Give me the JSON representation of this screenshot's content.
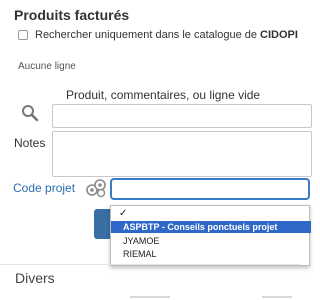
{
  "section": {
    "title": "Produits facturés",
    "search_catalog_prefix": "Rechercher uniquement dans le catalogue de ",
    "search_catalog_bold": "CIDOPI",
    "no_line": "Aucune ligne"
  },
  "product": {
    "label": "Produit, commentaires, ou ligne vide",
    "value": ""
  },
  "notes": {
    "label": "Notes",
    "value": ""
  },
  "code_projet": {
    "label": "Code projet",
    "value": "",
    "options": {
      "checkmark": "✓",
      "items": [
        "ASPBTP - Conseils ponctuels projet",
        "JYAMOE",
        "RIEMAL"
      ],
      "selected_index": 0
    }
  },
  "divers": {
    "label": "Divers"
  },
  "colors": {
    "link_blue": "#2a6fb0",
    "focus_border": "#3a7cc4",
    "highlight": "#2f68c8",
    "button_blue": "#3a6fa6"
  }
}
